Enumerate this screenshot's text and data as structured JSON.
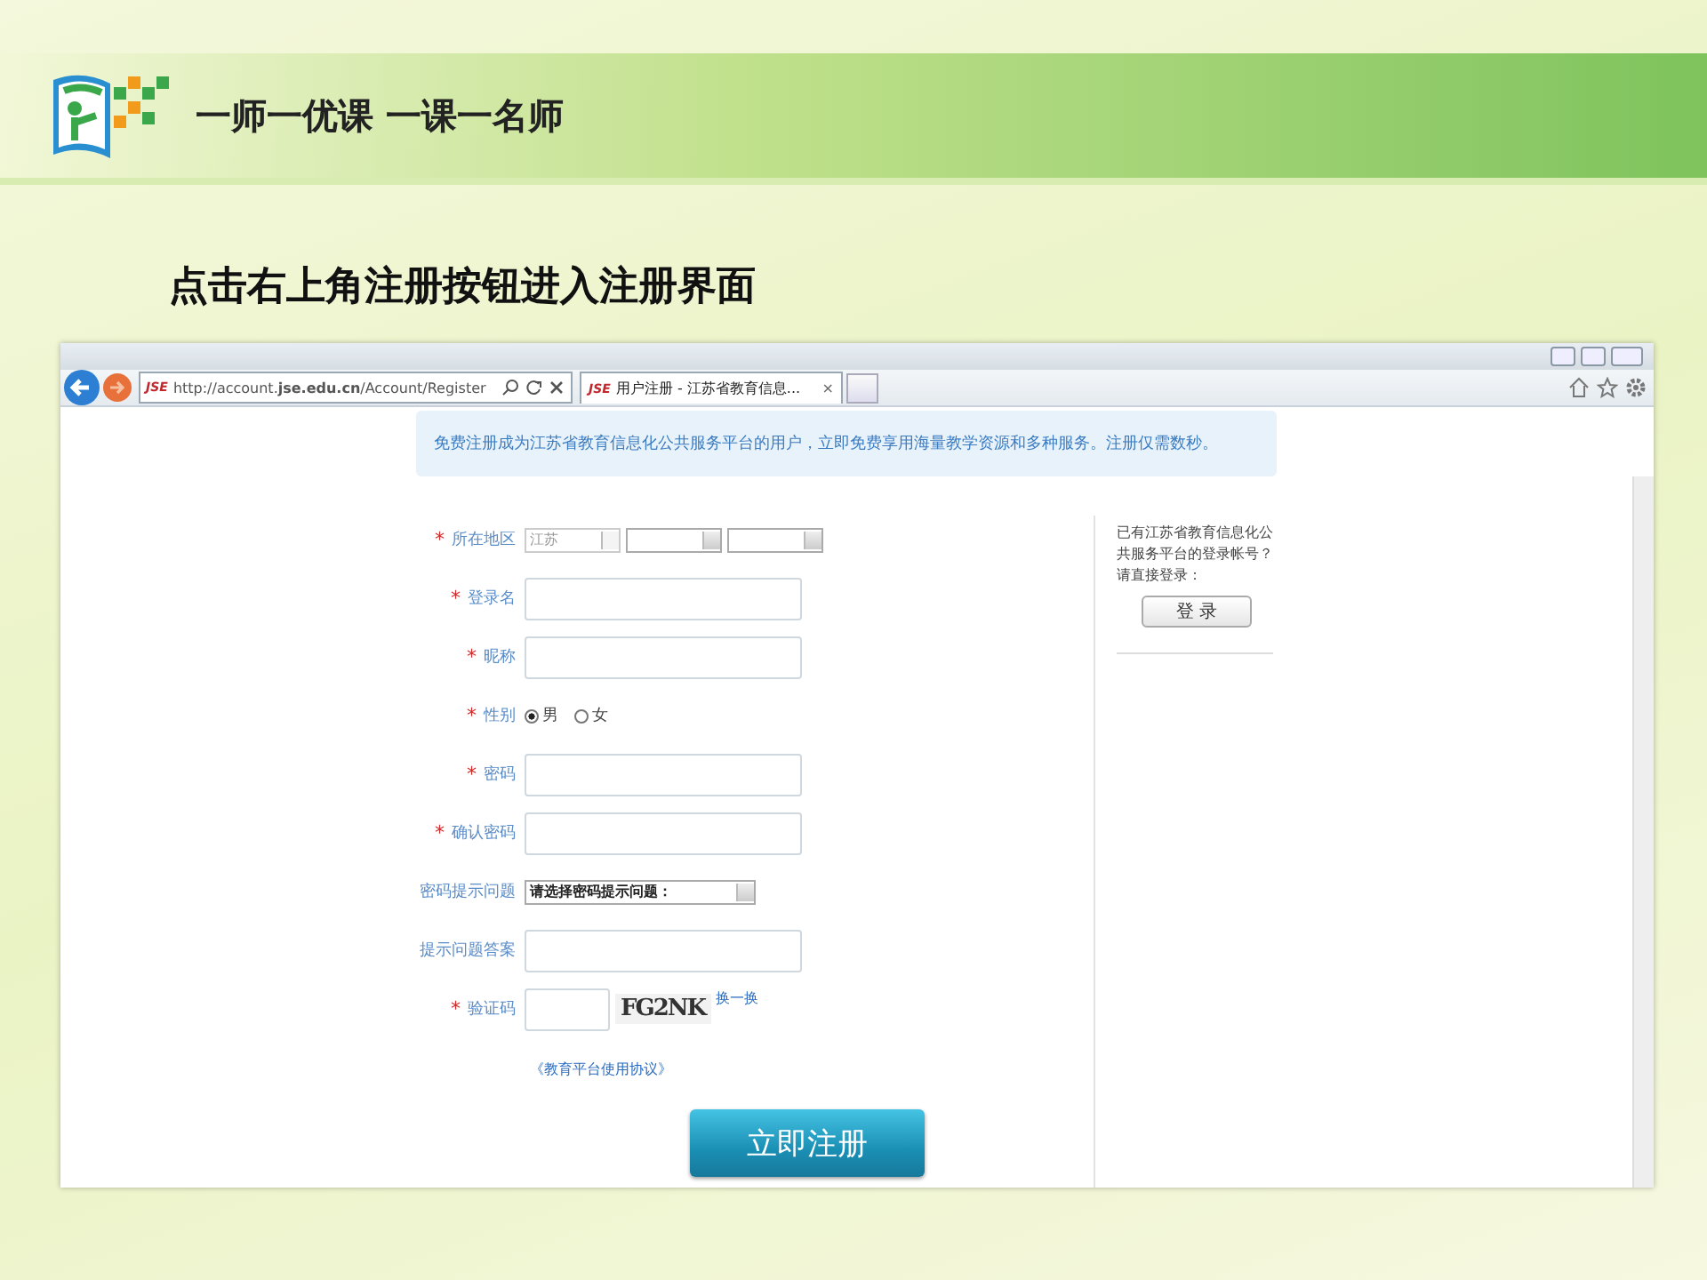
{
  "header": {
    "logo_text": "一师一优课 一课一名师"
  },
  "slide_title": "点击右上角注册按钮进入注册界面",
  "browser": {
    "address_favicon": "JSE",
    "address": "http://account.**jse.edu.cn**/Account/Register",
    "tab_favicon": "JSE",
    "tab_title": "用户注册 - 江苏省教育信息...",
    "tab_close": "×"
  },
  "notice": "免费注册成为江苏省教育信息化公共服务平台的用户，立即免费享用海量教学资源和多种服务。注册仅需数秒。",
  "form": {
    "fields": [
      {
        "kind": "region",
        "required_mark": "*",
        "label": "所在地区",
        "selects": [
          {
            "value": "江苏",
            "disabled": true
          },
          {
            "disabled": false
          },
          {
            "disabled": false
          }
        ]
      },
      {
        "kind": "text",
        "required_mark": "*",
        "label": "登录名"
      },
      {
        "kind": "text",
        "required_mark": "*",
        "label": "昵称"
      },
      {
        "kind": "radio",
        "required_mark": "*",
        "label": "性别",
        "options": [
          {
            "label": "男",
            "selected": true
          },
          {
            "label": "女",
            "selected": false
          }
        ]
      },
      {
        "kind": "text",
        "required_mark": "*",
        "label": "密码"
      },
      {
        "kind": "text",
        "required_mark": "*",
        "label": "确认密码"
      },
      {
        "kind": "select",
        "label": "密码提示问题",
        "value": "请选择密码提示问题："
      },
      {
        "kind": "text",
        "label": "提示问题答案"
      },
      {
        "kind": "captcha",
        "required_mark": "*",
        "label": "验证码",
        "captcha": "FG2NK",
        "refresh": "换一换"
      }
    ],
    "agreement": "《教育平台使用协议》",
    "submit": "立即注册"
  },
  "login_panel": {
    "text": "已有江苏省教育信息化公共服务平台的登录帐号？请直接登录：",
    "button": "登 录"
  }
}
